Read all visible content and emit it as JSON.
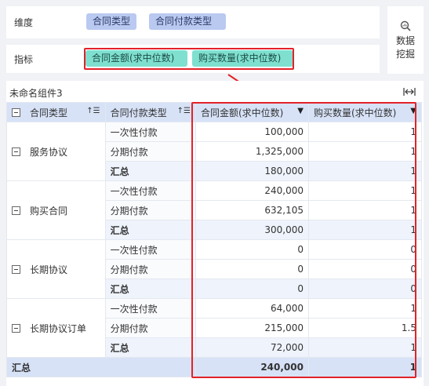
{
  "dimension_panel": {
    "label": "维度",
    "pills": [
      "合同类型",
      "合同付款类型"
    ]
  },
  "measure_panel": {
    "label": "指标",
    "pills": [
      "合同金额(求中位数)",
      "购买数量(求中位数)"
    ]
  },
  "data_mining": {
    "label_line1": "数据",
    "label_line2": "挖掘",
    "icon": "search-chart-icon"
  },
  "widget": {
    "title": "未命名组件3",
    "expand_icon": "expand-width-icon",
    "columns": [
      "合同类型",
      "合同付款类型",
      "合同金额(求中位数)",
      "购买数量(求中位数)"
    ],
    "groups": [
      {
        "name": "服务协议",
        "rows": [
          {
            "type": "一次性付款",
            "amount": "100,000",
            "qty": "1"
          },
          {
            "type": "分期付款",
            "amount": "1,325,000",
            "qty": "1"
          },
          {
            "type": "汇总",
            "amount": "180,000",
            "qty": "1"
          }
        ]
      },
      {
        "name": "购买合同",
        "rows": [
          {
            "type": "一次性付款",
            "amount": "240,000",
            "qty": "1"
          },
          {
            "type": "分期付款",
            "amount": "632,105",
            "qty": "1"
          },
          {
            "type": "汇总",
            "amount": "300,000",
            "qty": "1"
          }
        ]
      },
      {
        "name": "长期协议",
        "rows": [
          {
            "type": "一次性付款",
            "amount": "0",
            "qty": "0"
          },
          {
            "type": "分期付款",
            "amount": "0",
            "qty": "0"
          },
          {
            "type": "汇总",
            "amount": "0",
            "qty": "0"
          }
        ]
      },
      {
        "name": "长期协议订单",
        "rows": [
          {
            "type": "一次性付款",
            "amount": "64,000",
            "qty": "1"
          },
          {
            "type": "分期付款",
            "amount": "215,000",
            "qty": "1.5"
          },
          {
            "type": "汇总",
            "amount": "72,000",
            "qty": "1"
          }
        ]
      }
    ],
    "grand_total": {
      "label": "汇总",
      "amount": "240,000",
      "qty": "1"
    }
  },
  "colors": {
    "highlight_red": "#e32229",
    "dimension_pill": "#b9c9f0",
    "measure_pill": "#7fe0d0",
    "header_bg": "#d7e2f7"
  }
}
